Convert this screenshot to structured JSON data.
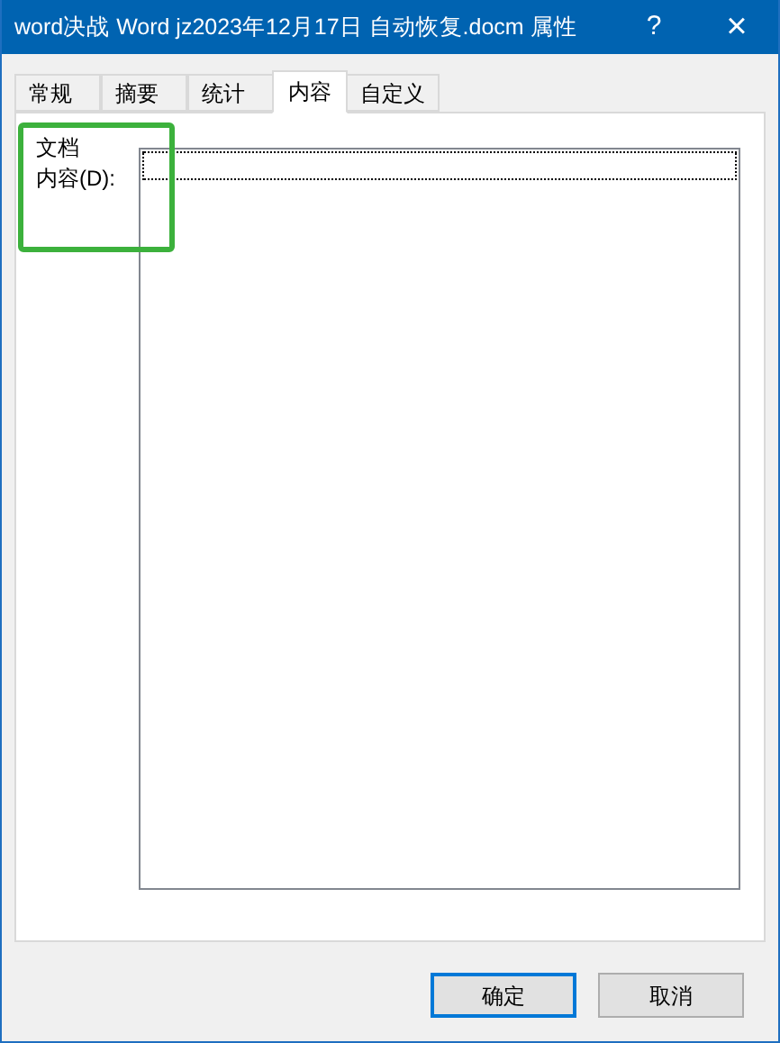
{
  "window": {
    "title": "word决战 Word jz2023年12月17日 自动恢复.docm 属性",
    "help": "?",
    "close": "×"
  },
  "tabs": [
    {
      "label": "常规",
      "selected": false
    },
    {
      "label": "摘要",
      "selected": false
    },
    {
      "label": "统计",
      "selected": false
    },
    {
      "label": "内容",
      "selected": true
    },
    {
      "label": "自定义",
      "selected": false
    }
  ],
  "content": {
    "label_lines": [
      "文档",
      "内容(D):"
    ],
    "highlighted": true
  },
  "buttons": [
    {
      "label": "确定",
      "default": true
    },
    {
      "label": "取消",
      "default": false
    }
  ]
}
